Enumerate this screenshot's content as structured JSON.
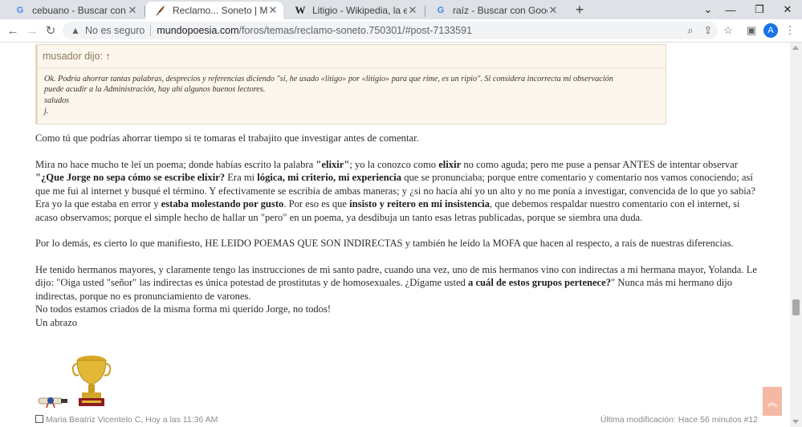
{
  "browser": {
    "tabs": [
      {
        "title": "cebuano - Buscar con Google",
        "favicon": "google-icon"
      },
      {
        "title": "Reclamo... Soneto | Mundo Poesía",
        "favicon": "feather-icon"
      },
      {
        "title": "Litigio - Wikipedia, la enciclopedia",
        "favicon": "wikipedia-icon"
      },
      {
        "title": "raíz - Buscar con Google",
        "favicon": "google-icon"
      }
    ],
    "omnibox": {
      "security_label": "No es seguro",
      "url_host": "mundopoesia.com",
      "url_path": "/foros/temas/reclamo-soneto.750301/#post-7133591"
    },
    "profile_initial": "A"
  },
  "quote": {
    "author_label": "musador dijo:",
    "arrow": "↑",
    "lines": [
      "Ok. Podría ahorrar tantas palabras, desprecios y referencias diciendo \"sí, he usado «litigo» por «litigio» para que rime, es un ripio\". Si considera incorrecta mi observación",
      "puede acudir a la Administración, hay ahí algunos buenos lectores.",
      "saludos",
      "j."
    ]
  },
  "post": {
    "p1": "Como tú que podrías ahorrar tiempo si te tomaras el trabajito que investigar antes de comentar.",
    "p2": {
      "a": "Mira no hace mucho te leí un poema; donde habías escrito la palabra ",
      "b": "\"elixir\"",
      "c": "; yo la conozco como ",
      "d": "elixir",
      "e": " no como aguda; pero me puse a pensar ANTES de intentar observar ",
      "f": "\"¿Que Jorge no sepa cómo se escribe elíxir?",
      "g": " Era mi ",
      "h": "lógica, mi criterio, mi experiencia",
      "i": " que se pronunciaba; porque entre comentario y comentario nos vamos conociendo; así que me fui al internet y busqué el término. Y efectivamente se escribía de ambas maneras; y ¿si no hacía ahí yo un alto y no me ponía a investigar, convencida de lo que yo sabía? Era yo la que estaba en error y ",
      "j": "estaba molestando por gusto",
      "k": ". Por eso es que ",
      "l": "insisto y reitero en mi insistencia",
      "m": ", que debemos respaldar nuestro comentario con el internet, si acaso observamos; porque el simple hecho de hallar un \"pero\" en un poema, ya desdibuja un tanto esas letras publicadas, porque se siembra una duda."
    },
    "p3": "Por lo demás, es cierto lo que manifiesto, HE LEIDO POEMAS QUE SON INDIRECTAS y también he leído la MOFA que hacen al respecto, a raís de nuestras diferencias.",
    "p4": {
      "a": "He tenido hermanos mayores, y claramente tengo las instrucciones de mi santo padre, cuando una vez, uno de mis hermanos vino con indirectas a mi hermana mayor, Yolanda. Le dijo: \"Oiga usted \"señor\" las indirectas es única potestad de prostitutas y de homosexuales. ¿Dígame usted ",
      "b": "a cuál de estos grupos pertenece?",
      "c": "\" Nunca más mi hermano dijo indirectas, porque no es pronunciamiento de varones."
    },
    "p5": "No todos estamos criados de la misma forma mi querido Jorge, no todos!",
    "p6": "Un abrazo"
  },
  "footer": {
    "author_time": "Maria Beatriz Vicentelo C, Hoy a las 11:36 AM",
    "last_modified": "Última modificación: Hace 56 minutos",
    "post_number": "#12"
  },
  "colors": {
    "quote_bg": "#fdf6ec",
    "to_top_button": "#f4b9a5",
    "profile": "#1a73e8"
  }
}
